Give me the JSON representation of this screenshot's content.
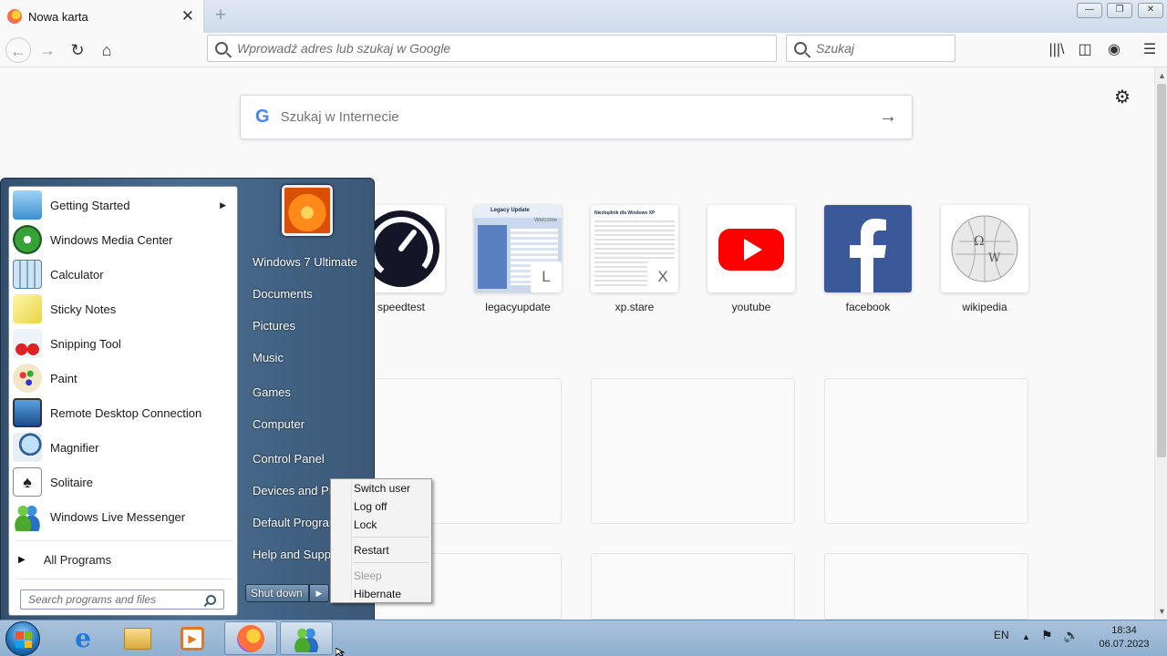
{
  "browser": {
    "tab_title": "Nowa karta",
    "url_placeholder": "Wprowadź adres lub szukaj w Google",
    "search_placeholder": "Szukaj",
    "close_symbol": "✕",
    "new_tab_symbol": "+"
  },
  "newtab": {
    "search_placeholder": "Szukaj w Internecie",
    "tiles": [
      {
        "label": "speedtest"
      },
      {
        "label": "legacyupdate",
        "badge": "L",
        "thumb_title": "Legacy Update",
        "thumb_tab": "Welcome"
      },
      {
        "label": "xp.stare",
        "badge": "X",
        "thumb_title": "Niezbędnik dla Windows XP"
      },
      {
        "label": "youtube"
      },
      {
        "label": "facebook"
      },
      {
        "label": "wikipedia"
      }
    ]
  },
  "start_menu": {
    "programs": [
      {
        "label": "Getting Started",
        "icon": "getting-started-icon",
        "submenu": true
      },
      {
        "label": "Windows Media Center",
        "icon": "media-center-icon"
      },
      {
        "label": "Calculator",
        "icon": "calculator-icon"
      },
      {
        "label": "Sticky Notes",
        "icon": "sticky-notes-icon"
      },
      {
        "label": "Snipping Tool",
        "icon": "snipping-tool-icon"
      },
      {
        "label": "Paint",
        "icon": "paint-icon"
      },
      {
        "label": "Remote Desktop Connection",
        "icon": "remote-desktop-icon"
      },
      {
        "label": "Magnifier",
        "icon": "magnifier-icon"
      },
      {
        "label": "Solitaire",
        "icon": "solitaire-icon"
      },
      {
        "label": "Windows Live Messenger",
        "icon": "messenger-icon"
      }
    ],
    "all_programs": "All Programs",
    "search_placeholder": "Search programs and files",
    "right_items": [
      "Windows 7 Ultimate",
      "Documents",
      "Pictures",
      "Music",
      "Games",
      "Computer",
      "Control Panel",
      "Devices and Printers",
      "Default Programs",
      "Help and Support"
    ],
    "shutdown": "Shut down"
  },
  "shutdown_menu": {
    "items": [
      "Switch user",
      "Log off",
      "Lock",
      "Restart",
      "Sleep",
      "Hibernate"
    ],
    "disabled": [
      "Sleep"
    ]
  },
  "taskbar": {
    "language": "EN",
    "time": "18:34",
    "date": "06.07.2023"
  },
  "colors": {
    "youtube": "#ff0000",
    "facebook": "#3b5998",
    "firefox_accent": "#ff7139"
  }
}
